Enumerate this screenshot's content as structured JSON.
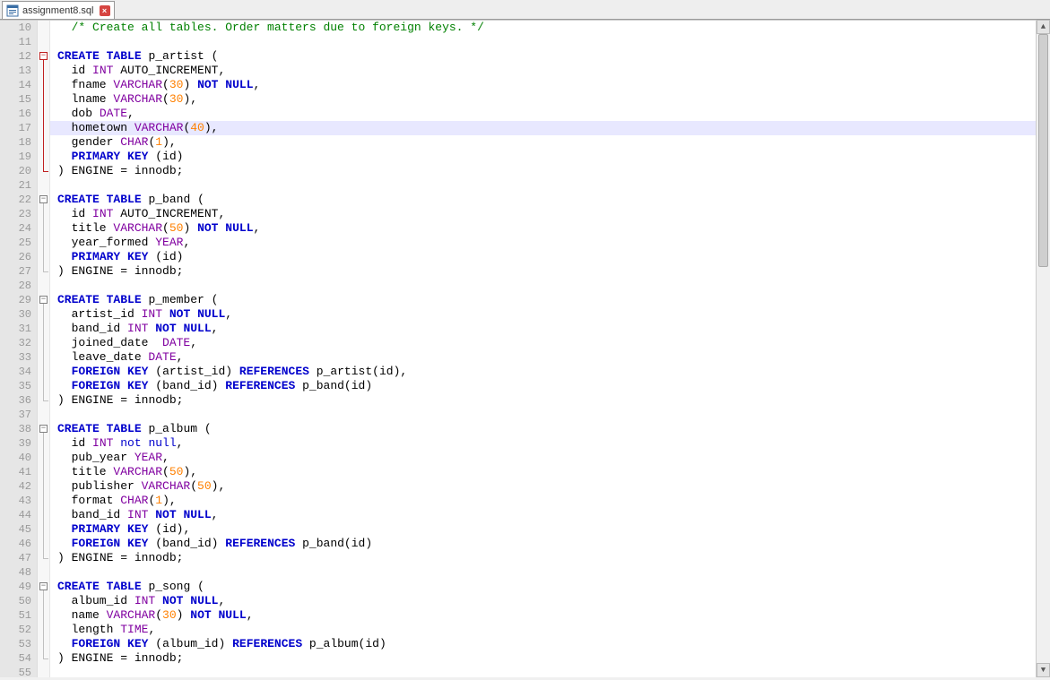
{
  "tab": {
    "filename": "assignment8.sql",
    "close_glyph": "×"
  },
  "line_start": 10,
  "line_end": 55,
  "highlighted_line": 17,
  "fold_regions": [
    {
      "start": 12,
      "end": 20,
      "red": true
    },
    {
      "start": 22,
      "end": 27,
      "red": false
    },
    {
      "start": 29,
      "end": 36,
      "red": false
    },
    {
      "start": 38,
      "end": 47,
      "red": false
    },
    {
      "start": 49,
      "end": 54,
      "red": false
    }
  ],
  "code": [
    {
      "n": 10,
      "t": [
        [
          "  ",
          "pl"
        ],
        [
          "/* Create all tables. Order matters due to foreign keys. */",
          "comment"
        ]
      ]
    },
    {
      "n": 11,
      "t": []
    },
    {
      "n": 12,
      "t": [
        [
          "CREATE",
          "kw"
        ],
        [
          " ",
          "pl"
        ],
        [
          "TABLE",
          "kw"
        ],
        [
          " p_artist ",
          "id"
        ],
        [
          "(",
          "pl"
        ]
      ]
    },
    {
      "n": 13,
      "t": [
        [
          "  id ",
          "id"
        ],
        [
          "INT",
          "type"
        ],
        [
          " AUTO_INCREMENT",
          "id"
        ],
        [
          ",",
          "pl"
        ]
      ]
    },
    {
      "n": 14,
      "t": [
        [
          "  fname ",
          "id"
        ],
        [
          "VARCHAR",
          "type"
        ],
        [
          "(",
          "pl"
        ],
        [
          "30",
          "num"
        ],
        [
          ")",
          "pl"
        ],
        [
          " ",
          "pl"
        ],
        [
          "NOT",
          "kw"
        ],
        [
          " ",
          "pl"
        ],
        [
          "NULL",
          "kw"
        ],
        [
          ",",
          "pl"
        ]
      ]
    },
    {
      "n": 15,
      "t": [
        [
          "  lname ",
          "id"
        ],
        [
          "VARCHAR",
          "type"
        ],
        [
          "(",
          "pl"
        ],
        [
          "30",
          "num"
        ],
        [
          ")",
          "pl"
        ],
        [
          ",",
          "pl"
        ]
      ]
    },
    {
      "n": 16,
      "t": [
        [
          "  dob ",
          "id"
        ],
        [
          "DATE",
          "type"
        ],
        [
          ",",
          "pl"
        ]
      ]
    },
    {
      "n": 17,
      "t": [
        [
          "  hometown ",
          "id"
        ],
        [
          "VARCHAR",
          "type"
        ],
        [
          "(",
          "pl"
        ],
        [
          "40",
          "num"
        ],
        [
          ")",
          "pl"
        ],
        [
          ",",
          "pl"
        ]
      ]
    },
    {
      "n": 18,
      "t": [
        [
          "  gender ",
          "id"
        ],
        [
          "CHAR",
          "type"
        ],
        [
          "(",
          "pl"
        ],
        [
          "1",
          "num"
        ],
        [
          ")",
          "pl"
        ],
        [
          ",",
          "pl"
        ]
      ]
    },
    {
      "n": 19,
      "t": [
        [
          "  ",
          "pl"
        ],
        [
          "PRIMARY",
          "kw"
        ],
        [
          " ",
          "pl"
        ],
        [
          "KEY",
          "kw"
        ],
        [
          " ",
          "pl"
        ],
        [
          "(",
          "pl"
        ],
        [
          "id",
          "id"
        ],
        [
          ")",
          "pl"
        ]
      ]
    },
    {
      "n": 20,
      "t": [
        [
          ")",
          "pl"
        ],
        [
          " ENGINE ",
          "id"
        ],
        [
          "=",
          "pl"
        ],
        [
          " innodb",
          "id"
        ],
        [
          ";",
          "pl"
        ]
      ]
    },
    {
      "n": 21,
      "t": []
    },
    {
      "n": 22,
      "t": [
        [
          "CREATE",
          "kw"
        ],
        [
          " ",
          "pl"
        ],
        [
          "TABLE",
          "kw"
        ],
        [
          " p_band ",
          "id"
        ],
        [
          "(",
          "pl"
        ]
      ]
    },
    {
      "n": 23,
      "t": [
        [
          "  id ",
          "id"
        ],
        [
          "INT",
          "type"
        ],
        [
          " AUTO_INCREMENT",
          "id"
        ],
        [
          ",",
          "pl"
        ]
      ]
    },
    {
      "n": 24,
      "t": [
        [
          "  title ",
          "id"
        ],
        [
          "VARCHAR",
          "type"
        ],
        [
          "(",
          "pl"
        ],
        [
          "50",
          "num"
        ],
        [
          ")",
          "pl"
        ],
        [
          " ",
          "pl"
        ],
        [
          "NOT",
          "kw"
        ],
        [
          " ",
          "pl"
        ],
        [
          "NULL",
          "kw"
        ],
        [
          ",",
          "pl"
        ]
      ]
    },
    {
      "n": 25,
      "t": [
        [
          "  year_formed ",
          "id"
        ],
        [
          "YEAR",
          "type"
        ],
        [
          ",",
          "pl"
        ]
      ]
    },
    {
      "n": 26,
      "t": [
        [
          "  ",
          "pl"
        ],
        [
          "PRIMARY",
          "kw"
        ],
        [
          " ",
          "pl"
        ],
        [
          "KEY",
          "kw"
        ],
        [
          " ",
          "pl"
        ],
        [
          "(",
          "pl"
        ],
        [
          "id",
          "id"
        ],
        [
          ")",
          "pl"
        ]
      ]
    },
    {
      "n": 27,
      "t": [
        [
          ")",
          "pl"
        ],
        [
          " ENGINE ",
          "id"
        ],
        [
          "=",
          "pl"
        ],
        [
          " innodb",
          "id"
        ],
        [
          ";",
          "pl"
        ]
      ]
    },
    {
      "n": 28,
      "t": []
    },
    {
      "n": 29,
      "t": [
        [
          "CREATE",
          "kw"
        ],
        [
          " ",
          "pl"
        ],
        [
          "TABLE",
          "kw"
        ],
        [
          " p_member ",
          "id"
        ],
        [
          "(",
          "pl"
        ]
      ]
    },
    {
      "n": 30,
      "t": [
        [
          "  artist_id ",
          "id"
        ],
        [
          "INT",
          "type"
        ],
        [
          " ",
          "pl"
        ],
        [
          "NOT",
          "kw"
        ],
        [
          " ",
          "pl"
        ],
        [
          "NULL",
          "kw"
        ],
        [
          ",",
          "pl"
        ]
      ]
    },
    {
      "n": 31,
      "t": [
        [
          "  band_id ",
          "id"
        ],
        [
          "INT",
          "type"
        ],
        [
          " ",
          "pl"
        ],
        [
          "NOT",
          "kw"
        ],
        [
          " ",
          "pl"
        ],
        [
          "NULL",
          "kw"
        ],
        [
          ",",
          "pl"
        ]
      ]
    },
    {
      "n": 32,
      "t": [
        [
          "  joined_date  ",
          "id"
        ],
        [
          "DATE",
          "type"
        ],
        [
          ",",
          "pl"
        ]
      ]
    },
    {
      "n": 33,
      "t": [
        [
          "  leave_date ",
          "id"
        ],
        [
          "DATE",
          "type"
        ],
        [
          ",",
          "pl"
        ]
      ]
    },
    {
      "n": 34,
      "t": [
        [
          "  ",
          "pl"
        ],
        [
          "FOREIGN",
          "kw"
        ],
        [
          " ",
          "pl"
        ],
        [
          "KEY",
          "kw"
        ],
        [
          " ",
          "pl"
        ],
        [
          "(",
          "pl"
        ],
        [
          "artist_id",
          "id"
        ],
        [
          ")",
          "pl"
        ],
        [
          " ",
          "pl"
        ],
        [
          "REFERENCES",
          "kw"
        ],
        [
          " p_artist",
          "id"
        ],
        [
          "(",
          "pl"
        ],
        [
          "id",
          "id"
        ],
        [
          ")",
          "pl"
        ],
        [
          ",",
          "pl"
        ]
      ]
    },
    {
      "n": 35,
      "t": [
        [
          "  ",
          "pl"
        ],
        [
          "FOREIGN",
          "kw"
        ],
        [
          " ",
          "pl"
        ],
        [
          "KEY",
          "kw"
        ],
        [
          " ",
          "pl"
        ],
        [
          "(",
          "pl"
        ],
        [
          "band_id",
          "id"
        ],
        [
          ")",
          "pl"
        ],
        [
          " ",
          "pl"
        ],
        [
          "REFERENCES",
          "kw"
        ],
        [
          " p_band",
          "id"
        ],
        [
          "(",
          "pl"
        ],
        [
          "id",
          "id"
        ],
        [
          ")",
          "pl"
        ]
      ]
    },
    {
      "n": 36,
      "t": [
        [
          ")",
          "pl"
        ],
        [
          " ENGINE ",
          "id"
        ],
        [
          "=",
          "pl"
        ],
        [
          " innodb",
          "id"
        ],
        [
          ";",
          "pl"
        ]
      ]
    },
    {
      "n": 37,
      "t": []
    },
    {
      "n": 38,
      "t": [
        [
          "CREATE",
          "kw"
        ],
        [
          " ",
          "pl"
        ],
        [
          "TABLE",
          "kw"
        ],
        [
          " p_album ",
          "id"
        ],
        [
          "(",
          "pl"
        ]
      ]
    },
    {
      "n": 39,
      "t": [
        [
          "  id ",
          "id"
        ],
        [
          "INT",
          "type"
        ],
        [
          " ",
          "pl"
        ],
        [
          "not",
          "kw2"
        ],
        [
          " ",
          "pl"
        ],
        [
          "null",
          "kw2"
        ],
        [
          ",",
          "pl"
        ]
      ]
    },
    {
      "n": 40,
      "t": [
        [
          "  pub_year ",
          "id"
        ],
        [
          "YEAR",
          "type"
        ],
        [
          ",",
          "pl"
        ]
      ]
    },
    {
      "n": 41,
      "t": [
        [
          "  title ",
          "id"
        ],
        [
          "VARCHAR",
          "type"
        ],
        [
          "(",
          "pl"
        ],
        [
          "50",
          "num"
        ],
        [
          ")",
          "pl"
        ],
        [
          ",",
          "pl"
        ]
      ]
    },
    {
      "n": 42,
      "t": [
        [
          "  publisher ",
          "id"
        ],
        [
          "VARCHAR",
          "type"
        ],
        [
          "(",
          "pl"
        ],
        [
          "50",
          "num"
        ],
        [
          ")",
          "pl"
        ],
        [
          ",",
          "pl"
        ]
      ]
    },
    {
      "n": 43,
      "t": [
        [
          "  format ",
          "id"
        ],
        [
          "CHAR",
          "type"
        ],
        [
          "(",
          "pl"
        ],
        [
          "1",
          "num"
        ],
        [
          ")",
          "pl"
        ],
        [
          ",",
          "pl"
        ]
      ]
    },
    {
      "n": 44,
      "t": [
        [
          "  band_id ",
          "id"
        ],
        [
          "INT",
          "type"
        ],
        [
          " ",
          "pl"
        ],
        [
          "NOT",
          "kw"
        ],
        [
          " ",
          "pl"
        ],
        [
          "NULL",
          "kw"
        ],
        [
          ",",
          "pl"
        ]
      ]
    },
    {
      "n": 45,
      "t": [
        [
          "  ",
          "pl"
        ],
        [
          "PRIMARY",
          "kw"
        ],
        [
          " ",
          "pl"
        ],
        [
          "KEY",
          "kw"
        ],
        [
          " ",
          "pl"
        ],
        [
          "(",
          "pl"
        ],
        [
          "id",
          "id"
        ],
        [
          ")",
          "pl"
        ],
        [
          ",",
          "pl"
        ]
      ]
    },
    {
      "n": 46,
      "t": [
        [
          "  ",
          "pl"
        ],
        [
          "FOREIGN",
          "kw"
        ],
        [
          " ",
          "pl"
        ],
        [
          "KEY",
          "kw"
        ],
        [
          " ",
          "pl"
        ],
        [
          "(",
          "pl"
        ],
        [
          "band_id",
          "id"
        ],
        [
          ")",
          "pl"
        ],
        [
          " ",
          "pl"
        ],
        [
          "REFERENCES",
          "kw"
        ],
        [
          " p_band",
          "id"
        ],
        [
          "(",
          "pl"
        ],
        [
          "id",
          "id"
        ],
        [
          ")",
          "pl"
        ]
      ]
    },
    {
      "n": 47,
      "t": [
        [
          ")",
          "pl"
        ],
        [
          " ENGINE ",
          "id"
        ],
        [
          "=",
          "pl"
        ],
        [
          " innodb",
          "id"
        ],
        [
          ";",
          "pl"
        ]
      ]
    },
    {
      "n": 48,
      "t": []
    },
    {
      "n": 49,
      "t": [
        [
          "CREATE",
          "kw"
        ],
        [
          " ",
          "pl"
        ],
        [
          "TABLE",
          "kw"
        ],
        [
          " p_song ",
          "id"
        ],
        [
          "(",
          "pl"
        ]
      ]
    },
    {
      "n": 50,
      "t": [
        [
          "  album_id ",
          "id"
        ],
        [
          "INT",
          "type"
        ],
        [
          " ",
          "pl"
        ],
        [
          "NOT",
          "kw"
        ],
        [
          " ",
          "pl"
        ],
        [
          "NULL",
          "kw"
        ],
        [
          ",",
          "pl"
        ]
      ]
    },
    {
      "n": 51,
      "t": [
        [
          "  name ",
          "id"
        ],
        [
          "VARCHAR",
          "type"
        ],
        [
          "(",
          "pl"
        ],
        [
          "30",
          "num"
        ],
        [
          ")",
          "pl"
        ],
        [
          " ",
          "pl"
        ],
        [
          "NOT",
          "kw"
        ],
        [
          " ",
          "pl"
        ],
        [
          "NULL",
          "kw"
        ],
        [
          ",",
          "pl"
        ]
      ]
    },
    {
      "n": 52,
      "t": [
        [
          "  length ",
          "id"
        ],
        [
          "TIME",
          "type"
        ],
        [
          ",",
          "pl"
        ]
      ]
    },
    {
      "n": 53,
      "t": [
        [
          "  ",
          "pl"
        ],
        [
          "FOREIGN",
          "kw"
        ],
        [
          " ",
          "pl"
        ],
        [
          "KEY",
          "kw"
        ],
        [
          " ",
          "pl"
        ],
        [
          "(",
          "pl"
        ],
        [
          "album_id",
          "id"
        ],
        [
          ")",
          "pl"
        ],
        [
          " ",
          "pl"
        ],
        [
          "REFERENCES",
          "kw"
        ],
        [
          " p_album",
          "id"
        ],
        [
          "(",
          "pl"
        ],
        [
          "id",
          "id"
        ],
        [
          ")",
          "pl"
        ]
      ]
    },
    {
      "n": 54,
      "t": [
        [
          ")",
          "pl"
        ],
        [
          " ENGINE ",
          "id"
        ],
        [
          "=",
          "pl"
        ],
        [
          " innodb",
          "id"
        ],
        [
          ";",
          "pl"
        ]
      ]
    },
    {
      "n": 55,
      "t": []
    }
  ]
}
